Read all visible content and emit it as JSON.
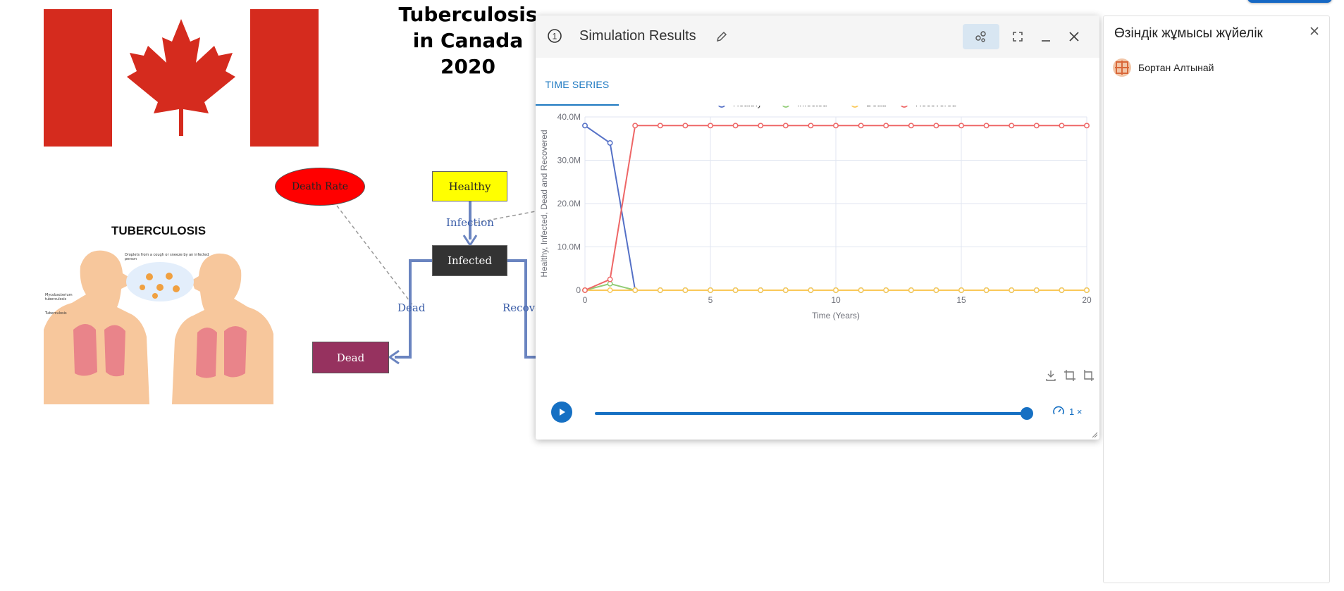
{
  "diagram": {
    "title_lines": [
      "Tuberculosis",
      "in Canada",
      "2020"
    ],
    "nodes": {
      "death_rate": "Death Rate",
      "healthy": "Healthy",
      "infected": "Infected",
      "dead": "Dead"
    },
    "edge_labels": {
      "infection": "Infection",
      "dead": "Dead",
      "recovered": "Recover"
    },
    "illustration": {
      "title": "TUBERCULOSIS",
      "captions": [
        "Droplets from a cough or sneeze by an infected person",
        "Mycobacterium tuberculosis",
        "Tuberculosis"
      ]
    }
  },
  "dialog": {
    "info_icon": "info-circle-icon",
    "title": "Simulation Results",
    "buttons": [
      "edit-pencil-icon",
      "sharing-icon",
      "fullscreen-icon",
      "minimize-icon",
      "close-icon"
    ],
    "tabs": [
      {
        "label": "TIME SERIES",
        "active": true
      }
    ],
    "toolbar_icons": [
      "download-icon",
      "crop-icon",
      "restore-crop-icon"
    ],
    "playback": {
      "speed_label": "1 ×",
      "progress": 1.0
    }
  },
  "chart_data": {
    "type": "line",
    "xlabel": "Time (Years)",
    "ylabel": "Healthy, Infected, Dead and Recovered",
    "xlim": [
      0,
      20
    ],
    "ylim": [
      0,
      40000000
    ],
    "xticks": [
      "0",
      "5",
      "10",
      "15",
      "20"
    ],
    "yticks": [
      "0",
      "10.0M",
      "20.0M",
      "30.0M",
      "40.0M"
    ],
    "grid": true,
    "legend_position": "top-center",
    "x": [
      0,
      1,
      2,
      3,
      4,
      5,
      6,
      7,
      8,
      9,
      10,
      11,
      12,
      13,
      14,
      15,
      16,
      17,
      18,
      19,
      20
    ],
    "series": [
      {
        "name": "Healthy",
        "color": "#5470c6",
        "values": [
          38000000,
          34000000,
          0,
          0,
          0,
          0,
          0,
          0,
          0,
          0,
          0,
          0,
          0,
          0,
          0,
          0,
          0,
          0,
          0,
          0,
          0
        ]
      },
      {
        "name": "Infected",
        "color": "#91cc75",
        "values": [
          0,
          1500000,
          0,
          0,
          0,
          0,
          0,
          0,
          0,
          0,
          0,
          0,
          0,
          0,
          0,
          0,
          0,
          0,
          0,
          0,
          0
        ]
      },
      {
        "name": "Dead",
        "color": "#fac858",
        "values": [
          0,
          0,
          0,
          0,
          0,
          0,
          0,
          0,
          0,
          0,
          0,
          0,
          0,
          0,
          0,
          0,
          0,
          0,
          0,
          0,
          0
        ]
      },
      {
        "name": "Recovered",
        "color": "#ee6666",
        "values": [
          0,
          2500000,
          38000000,
          38000000,
          38000000,
          38000000,
          38000000,
          38000000,
          38000000,
          38000000,
          38000000,
          38000000,
          38000000,
          38000000,
          38000000,
          38000000,
          38000000,
          38000000,
          38000000,
          38000000,
          38000000
        ]
      }
    ]
  },
  "panel": {
    "title": "Өзіндік жұмысы жүйелік",
    "close_icon": "close-icon",
    "members": [
      {
        "name": "Бортан Алтынай",
        "avatar": "avatar-icon"
      }
    ]
  }
}
